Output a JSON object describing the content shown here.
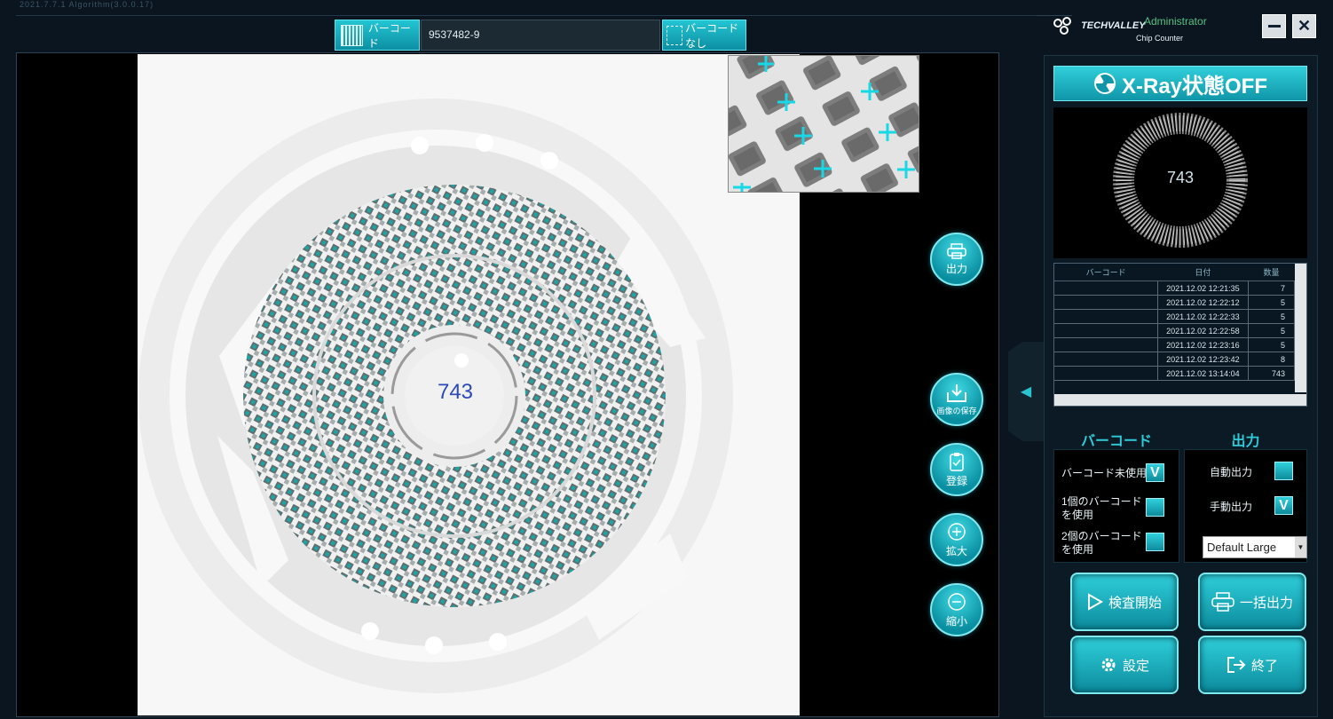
{
  "app": {
    "version_text": "2021.7.7.1     Algorithm(3.0.0.17)",
    "logo_text": "TECHVALLEY",
    "product_name": "Chip Counter",
    "user": "Administrator"
  },
  "toolbar": {
    "barcode_label": "バーコード",
    "barcode_value": "9537482-9",
    "no_barcode_label": "バーコードなし"
  },
  "viewer": {
    "count": "743"
  },
  "side_buttons": {
    "output": "出力",
    "save_image": "画像の保存",
    "register": "登録",
    "zoom_in": "拡大",
    "zoom_out": "縮小"
  },
  "status": {
    "xray": "X-Ray状態OFF"
  },
  "preview": {
    "count": "743"
  },
  "history": {
    "columns": [
      "バーコード",
      "日付",
      "数量"
    ],
    "rows": [
      {
        "barcode": "",
        "date": "2021.12.02 12:21:35",
        "qty": "7"
      },
      {
        "barcode": "",
        "date": "2021.12.02 12:22:12",
        "qty": "5"
      },
      {
        "barcode": "",
        "date": "2021.12.02 12:22:33",
        "qty": "5"
      },
      {
        "barcode": "",
        "date": "2021.12.02 12:22:58",
        "qty": "5"
      },
      {
        "barcode": "",
        "date": "2021.12.02 12:23:16",
        "qty": "5"
      },
      {
        "barcode": "",
        "date": "2021.12.02 12:23:42",
        "qty": "8"
      },
      {
        "barcode": "",
        "date": "2021.12.02 13:14:04",
        "qty": "743"
      }
    ]
  },
  "barcode_section": {
    "title": "バーコード",
    "options": [
      {
        "label": "バーコード未使用",
        "checked": true
      },
      {
        "label": "1個のバーコード\nを使用",
        "checked": false
      },
      {
        "label": "2個のバーコード\nを使用",
        "checked": false
      }
    ]
  },
  "output_section": {
    "title": "出力",
    "options": [
      {
        "label": "自動出力",
        "checked": false
      },
      {
        "label": "手動出力",
        "checked": true
      }
    ],
    "template": "Default Large"
  },
  "actions": {
    "start": "検査開始",
    "batch_output": "一括出力",
    "settings": "設定",
    "exit": "終了"
  },
  "checkmark": "V",
  "colors": {
    "accent": "#1fb6c6",
    "background": "#0a1520",
    "count_text": "#2b4ab8",
    "marker": "#19d8e6"
  }
}
